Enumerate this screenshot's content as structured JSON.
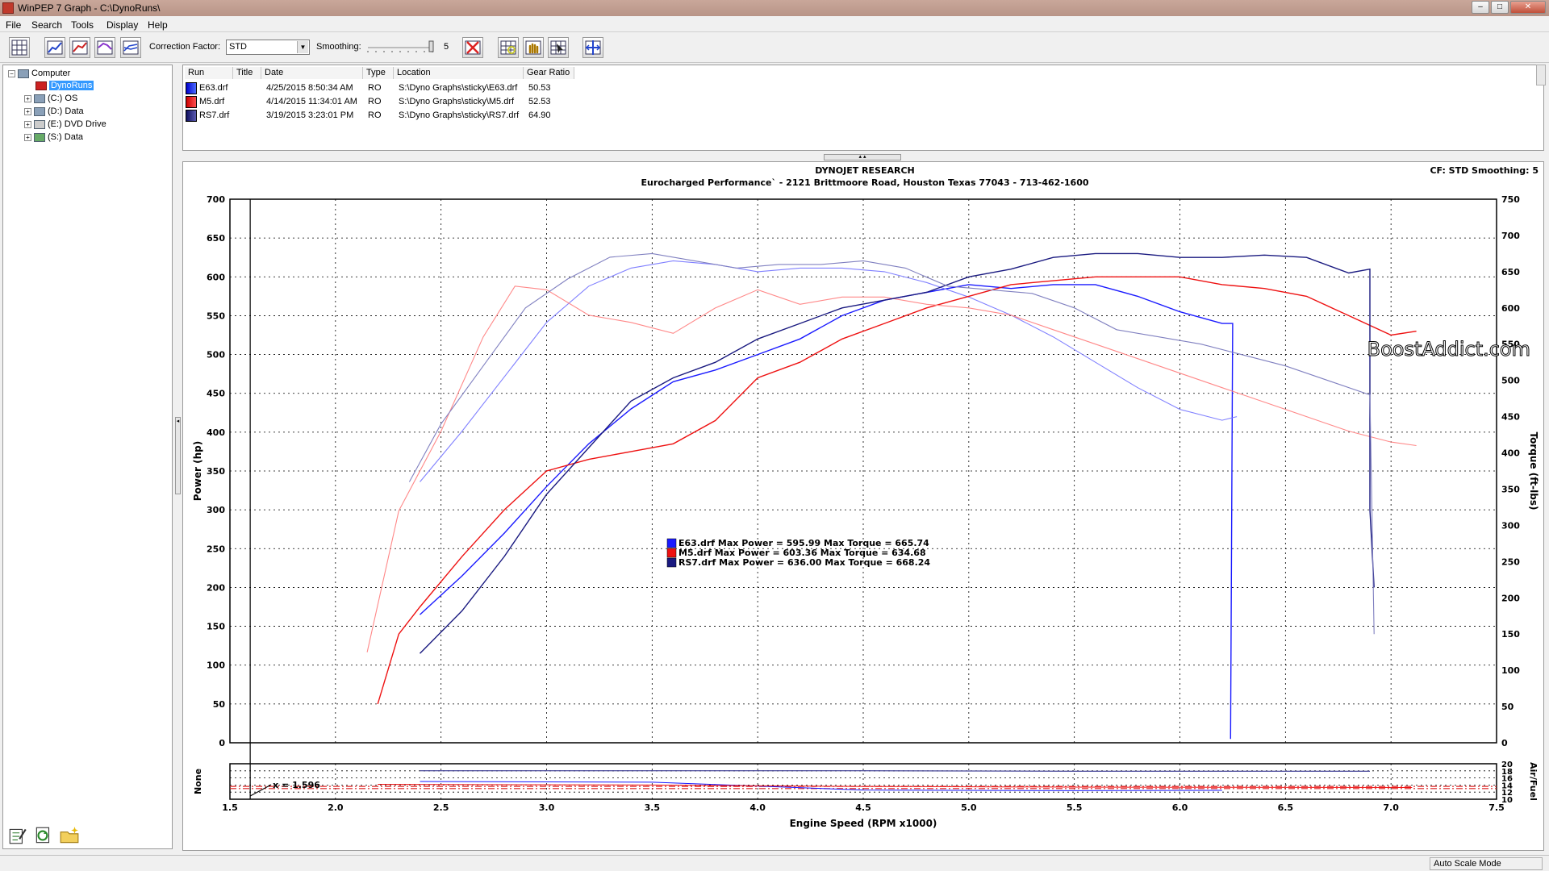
{
  "window": {
    "title": "WinPEP 7    Graph - C:\\DynoRuns\\"
  },
  "menu": [
    "File",
    "Search",
    "Tools",
    "Display",
    "Help"
  ],
  "toolbar": {
    "correction_label": "Correction Factor:",
    "correction_value": "STD",
    "smoothing_label": "Smoothing:",
    "smoothing_value": "5"
  },
  "tree": {
    "root": "Computer",
    "items": [
      "DynoRuns",
      "(C:) OS",
      "(D:) Data",
      "(E:) DVD Drive",
      "(S:) Data"
    ]
  },
  "runs": {
    "columns": [
      "Run",
      "Title",
      "Date",
      "Type",
      "Location",
      "Gear Ratio"
    ],
    "rows": [
      {
        "run": "E63.drf",
        "title": "",
        "date": "4/25/2015 8:50:34 AM",
        "type": "RO",
        "location": "S:\\Dyno Graphs\\sticky\\E63.drf",
        "gear": "50.53",
        "color": "#1a1aff"
      },
      {
        "run": "M5.drf",
        "title": "",
        "date": "4/14/2015 11:34:01 AM",
        "type": "RO",
        "location": "S:\\Dyno Graphs\\sticky\\M5.drf",
        "gear": "52.53",
        "color": "#ee1111"
      },
      {
        "run": "RS7.drf",
        "title": "",
        "date": "3/19/2015 3:23:01 PM",
        "type": "RO",
        "location": "S:\\Dyno Graphs\\sticky\\RS7.drf",
        "gear": "64.90",
        "color": "#1a1a80"
      }
    ]
  },
  "graph": {
    "header1": "DYNOJET RESEARCH",
    "header2": "Eurocharged Performance` - 2121 Brittmoore Road, Houston Texas 77043 - 713-462-1600",
    "cf_info": "CF: STD  Smoothing: 5",
    "watermark": "BoostAddict.com",
    "cursor_label": "x = 1.596",
    "legend": [
      "E63.drf Max Power = 595.99 Max Torque = 665.74",
      "M5.drf Max Power = 603.36 Max Torque = 634.68",
      "RS7.drf Max Power = 636.00 Max Torque = 668.24"
    ]
  },
  "chart_data": {
    "type": "line",
    "xlabel": "Engine Speed (RPM x1000)",
    "ylabel": "Power (hp)",
    "y2label": "Torque (ft-lbs)",
    "sub_ylabel": "None",
    "sub_y2label": "Air/Fuel",
    "xlim": [
      1.5,
      7.5
    ],
    "ylim": [
      0,
      700
    ],
    "y2lim": [
      0,
      750
    ],
    "sub_y2lim": [
      10,
      20
    ],
    "x_ticks": [
      "1.5",
      "2.0",
      "2.5",
      "3.0",
      "3.5",
      "4.0",
      "4.5",
      "5.0",
      "5.5",
      "6.0",
      "6.5",
      "7.0",
      "7.5"
    ],
    "y_ticks": [
      "0",
      "50",
      "100",
      "150",
      "200",
      "250",
      "300",
      "350",
      "400",
      "450",
      "500",
      "550",
      "600",
      "650",
      "700"
    ],
    "y2_ticks": [
      "0",
      "50",
      "100",
      "150",
      "200",
      "250",
      "300",
      "350",
      "400",
      "450",
      "500",
      "550",
      "600",
      "650",
      "700",
      "750"
    ],
    "sub_y2_ticks": [
      "10",
      "12",
      "14",
      "16",
      "18",
      "20"
    ],
    "series": [
      {
        "name": "E63.drf",
        "kind": "power",
        "color": "#1a1aff",
        "x": [
          2.4,
          2.6,
          2.8,
          3.0,
          3.2,
          3.4,
          3.6,
          3.8,
          4.0,
          4.2,
          4.4,
          4.6,
          4.8,
          5.0,
          5.2,
          5.4,
          5.6,
          5.8,
          6.0,
          6.2,
          6.25,
          6.24
        ],
        "y": [
          165,
          215,
          270,
          330,
          385,
          430,
          465,
          480,
          500,
          520,
          550,
          570,
          580,
          590,
          585,
          590,
          590,
          575,
          555,
          540,
          540,
          5
        ]
      },
      {
        "name": "E63.drf",
        "kind": "torque",
        "color": "#8080ff",
        "x": [
          2.4,
          2.6,
          2.8,
          3.0,
          3.2,
          3.4,
          3.6,
          3.8,
          4.0,
          4.2,
          4.4,
          4.6,
          4.8,
          5.0,
          5.2,
          5.4,
          5.6,
          5.8,
          6.0,
          6.2,
          6.27
        ],
        "y": [
          360,
          430,
          505,
          580,
          630,
          655,
          665,
          660,
          650,
          655,
          655,
          650,
          635,
          615,
          590,
          560,
          525,
          490,
          460,
          445,
          450
        ]
      },
      {
        "name": "M5.drf",
        "kind": "power",
        "color": "#ee1111",
        "x": [
          2.2,
          2.3,
          2.4,
          2.6,
          2.8,
          3.0,
          3.2,
          3.4,
          3.6,
          3.8,
          4.0,
          4.2,
          4.4,
          4.6,
          4.8,
          5.0,
          5.2,
          5.4,
          5.6,
          5.8,
          6.0,
          6.2,
          6.4,
          6.6,
          6.8,
          7.0,
          7.12
        ],
        "y": [
          50,
          140,
          175,
          240,
          300,
          350,
          365,
          375,
          385,
          415,
          470,
          490,
          520,
          540,
          560,
          575,
          590,
          595,
          600,
          600,
          600,
          590,
          585,
          575,
          550,
          525,
          530
        ]
      },
      {
        "name": "M5.drf",
        "kind": "torque",
        "color": "#ff8888",
        "x": [
          2.15,
          2.3,
          2.5,
          2.7,
          2.85,
          3.0,
          3.2,
          3.4,
          3.6,
          3.8,
          4.0,
          4.2,
          4.4,
          4.6,
          4.8,
          5.0,
          5.2,
          5.4,
          5.6,
          5.8,
          6.0,
          6.2,
          6.4,
          6.6,
          6.8,
          7.0,
          7.12
        ],
        "y": [
          125,
          320,
          430,
          560,
          630,
          625,
          590,
          580,
          565,
          600,
          625,
          605,
          615,
          615,
          605,
          600,
          590,
          570,
          550,
          530,
          510,
          490,
          470,
          450,
          430,
          415,
          410
        ]
      },
      {
        "name": "RS7.drf",
        "kind": "power",
        "color": "#1a1a80",
        "x": [
          2.4,
          2.6,
          2.8,
          3.0,
          3.2,
          3.4,
          3.6,
          3.8,
          4.0,
          4.2,
          4.4,
          4.6,
          4.8,
          5.0,
          5.2,
          5.4,
          5.6,
          5.8,
          6.0,
          6.2,
          6.4,
          6.6,
          6.8,
          6.9,
          6.9,
          6.92
        ],
        "y": [
          115,
          170,
          240,
          320,
          380,
          440,
          470,
          490,
          520,
          540,
          560,
          570,
          580,
          600,
          610,
          625,
          630,
          630,
          625,
          625,
          628,
          625,
          605,
          610,
          300,
          200
        ]
      },
      {
        "name": "RS7.drf",
        "kind": "torque",
        "color": "#8080c0",
        "x": [
          2.35,
          2.5,
          2.7,
          2.9,
          3.1,
          3.3,
          3.5,
          3.7,
          3.9,
          4.1,
          4.3,
          4.5,
          4.7,
          4.9,
          5.1,
          5.3,
          5.5,
          5.7,
          5.9,
          6.1,
          6.3,
          6.5,
          6.7,
          6.9,
          6.92
        ],
        "y": [
          360,
          440,
          520,
          600,
          640,
          670,
          675,
          665,
          655,
          660,
          660,
          665,
          655,
          630,
          625,
          620,
          600,
          570,
          560,
          550,
          535,
          520,
          500,
          480,
          150
        ]
      }
    ],
    "afr_series": [
      {
        "name": "E63.drf",
        "color": "#1a1aff",
        "x": [
          2.4,
          3.5,
          4.5,
          5.5,
          6.2
        ],
        "y": [
          15.0,
          14.8,
          12.6,
          12.4,
          12.5
        ]
      },
      {
        "name": "M5.drf",
        "color": "#ee1111",
        "x": [
          2.2,
          3.5,
          4.5,
          5.5,
          7.1
        ],
        "y": [
          14.2,
          14.0,
          13.6,
          13.4,
          13.3
        ]
      },
      {
        "name": "RS7.drf",
        "color": "#1a1a80",
        "x": [
          2.4,
          3.5,
          4.5,
          5.5,
          6.9
        ],
        "y": [
          18.0,
          18.0,
          18.0,
          17.9,
          17.9
        ]
      }
    ],
    "afr_reference": [
      13.0,
      13.6
    ]
  },
  "status": {
    "mode": "Auto Scale Mode"
  }
}
